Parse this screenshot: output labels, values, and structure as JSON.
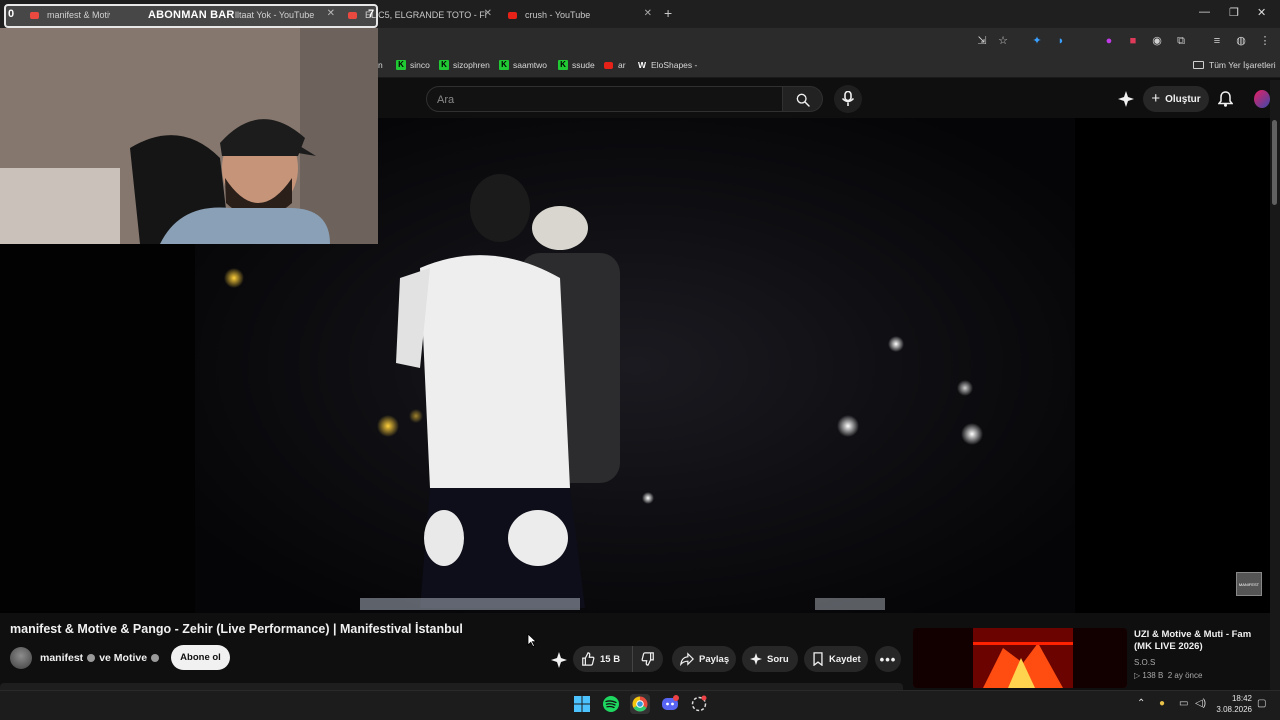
{
  "overlay": {
    "abone_left": "0",
    "abone_label": "ABONMAN BAR",
    "abone_right": "7"
  },
  "tabs": [
    {
      "title": "manifest & Motive & Pango - Zehir (Live Perfo"
    },
    {
      "title": "lltaat Yok - YouTube"
    },
    {
      "title": "EL C5, ELGRANDE TOTO - Fl"
    },
    {
      "title": "crush - YouTube"
    }
  ],
  "window_controls": {
    "minimize": "—",
    "maximize": "❐",
    "close": "✕"
  },
  "bookmarks": [
    {
      "label": "n",
      "icon": "none"
    },
    {
      "label": "sinco",
      "icon": "kick-icon"
    },
    {
      "label": "sizophren",
      "icon": "kick-icon"
    },
    {
      "label": "saamtwo",
      "icon": "kick-icon"
    },
    {
      "label": "ssude",
      "icon": "kick-icon"
    },
    {
      "label": "ar",
      "icon": "youtube-icon"
    },
    {
      "label": "EloShapes -",
      "icon": "eloshapes-icon"
    }
  ],
  "bookmarks_all": "Tüm Yer İşaretleri",
  "youtube": {
    "search_placeholder": "Ara",
    "create_label": "Oluştur"
  },
  "video": {
    "watermark": "MANIFEST",
    "title": "manifest & Motive & Pango - Zehir (Live Performance) | Manifestival İstanbul",
    "channel": "manifest",
    "channel_joiner": "ve Motive",
    "subscribe_label": "Abone ol",
    "like_count": "15 B",
    "share_label": "Paylaş",
    "ask_label": "Soru",
    "save_label": "Kaydet"
  },
  "recommendation": {
    "title": "UZI & Motive & Muti - Fam (MK LIVE 2026)",
    "channel": "S.O.S",
    "views": "▷ 138 B",
    "age": "2 ay önce"
  },
  "taskbar": {
    "time": "18:42",
    "date": "3.08.2026"
  },
  "colors": {
    "youtube_red": "#e62117",
    "kick_green": "#20c933",
    "background": "#0f0f0f"
  }
}
